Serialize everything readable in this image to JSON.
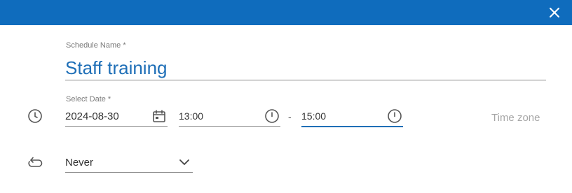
{
  "dialog": {
    "close_icon": "close-icon",
    "accent_color": "#0f6cbd"
  },
  "schedule": {
    "name_label": "Schedule Name *",
    "name_value": "Staff training"
  },
  "date": {
    "label": "Select Date *",
    "value": "2024-08-30",
    "start_time": "13:00",
    "separator": "-",
    "end_time": "15:00",
    "time_zone": "Time zone"
  },
  "repeat": {
    "value": "Never"
  }
}
